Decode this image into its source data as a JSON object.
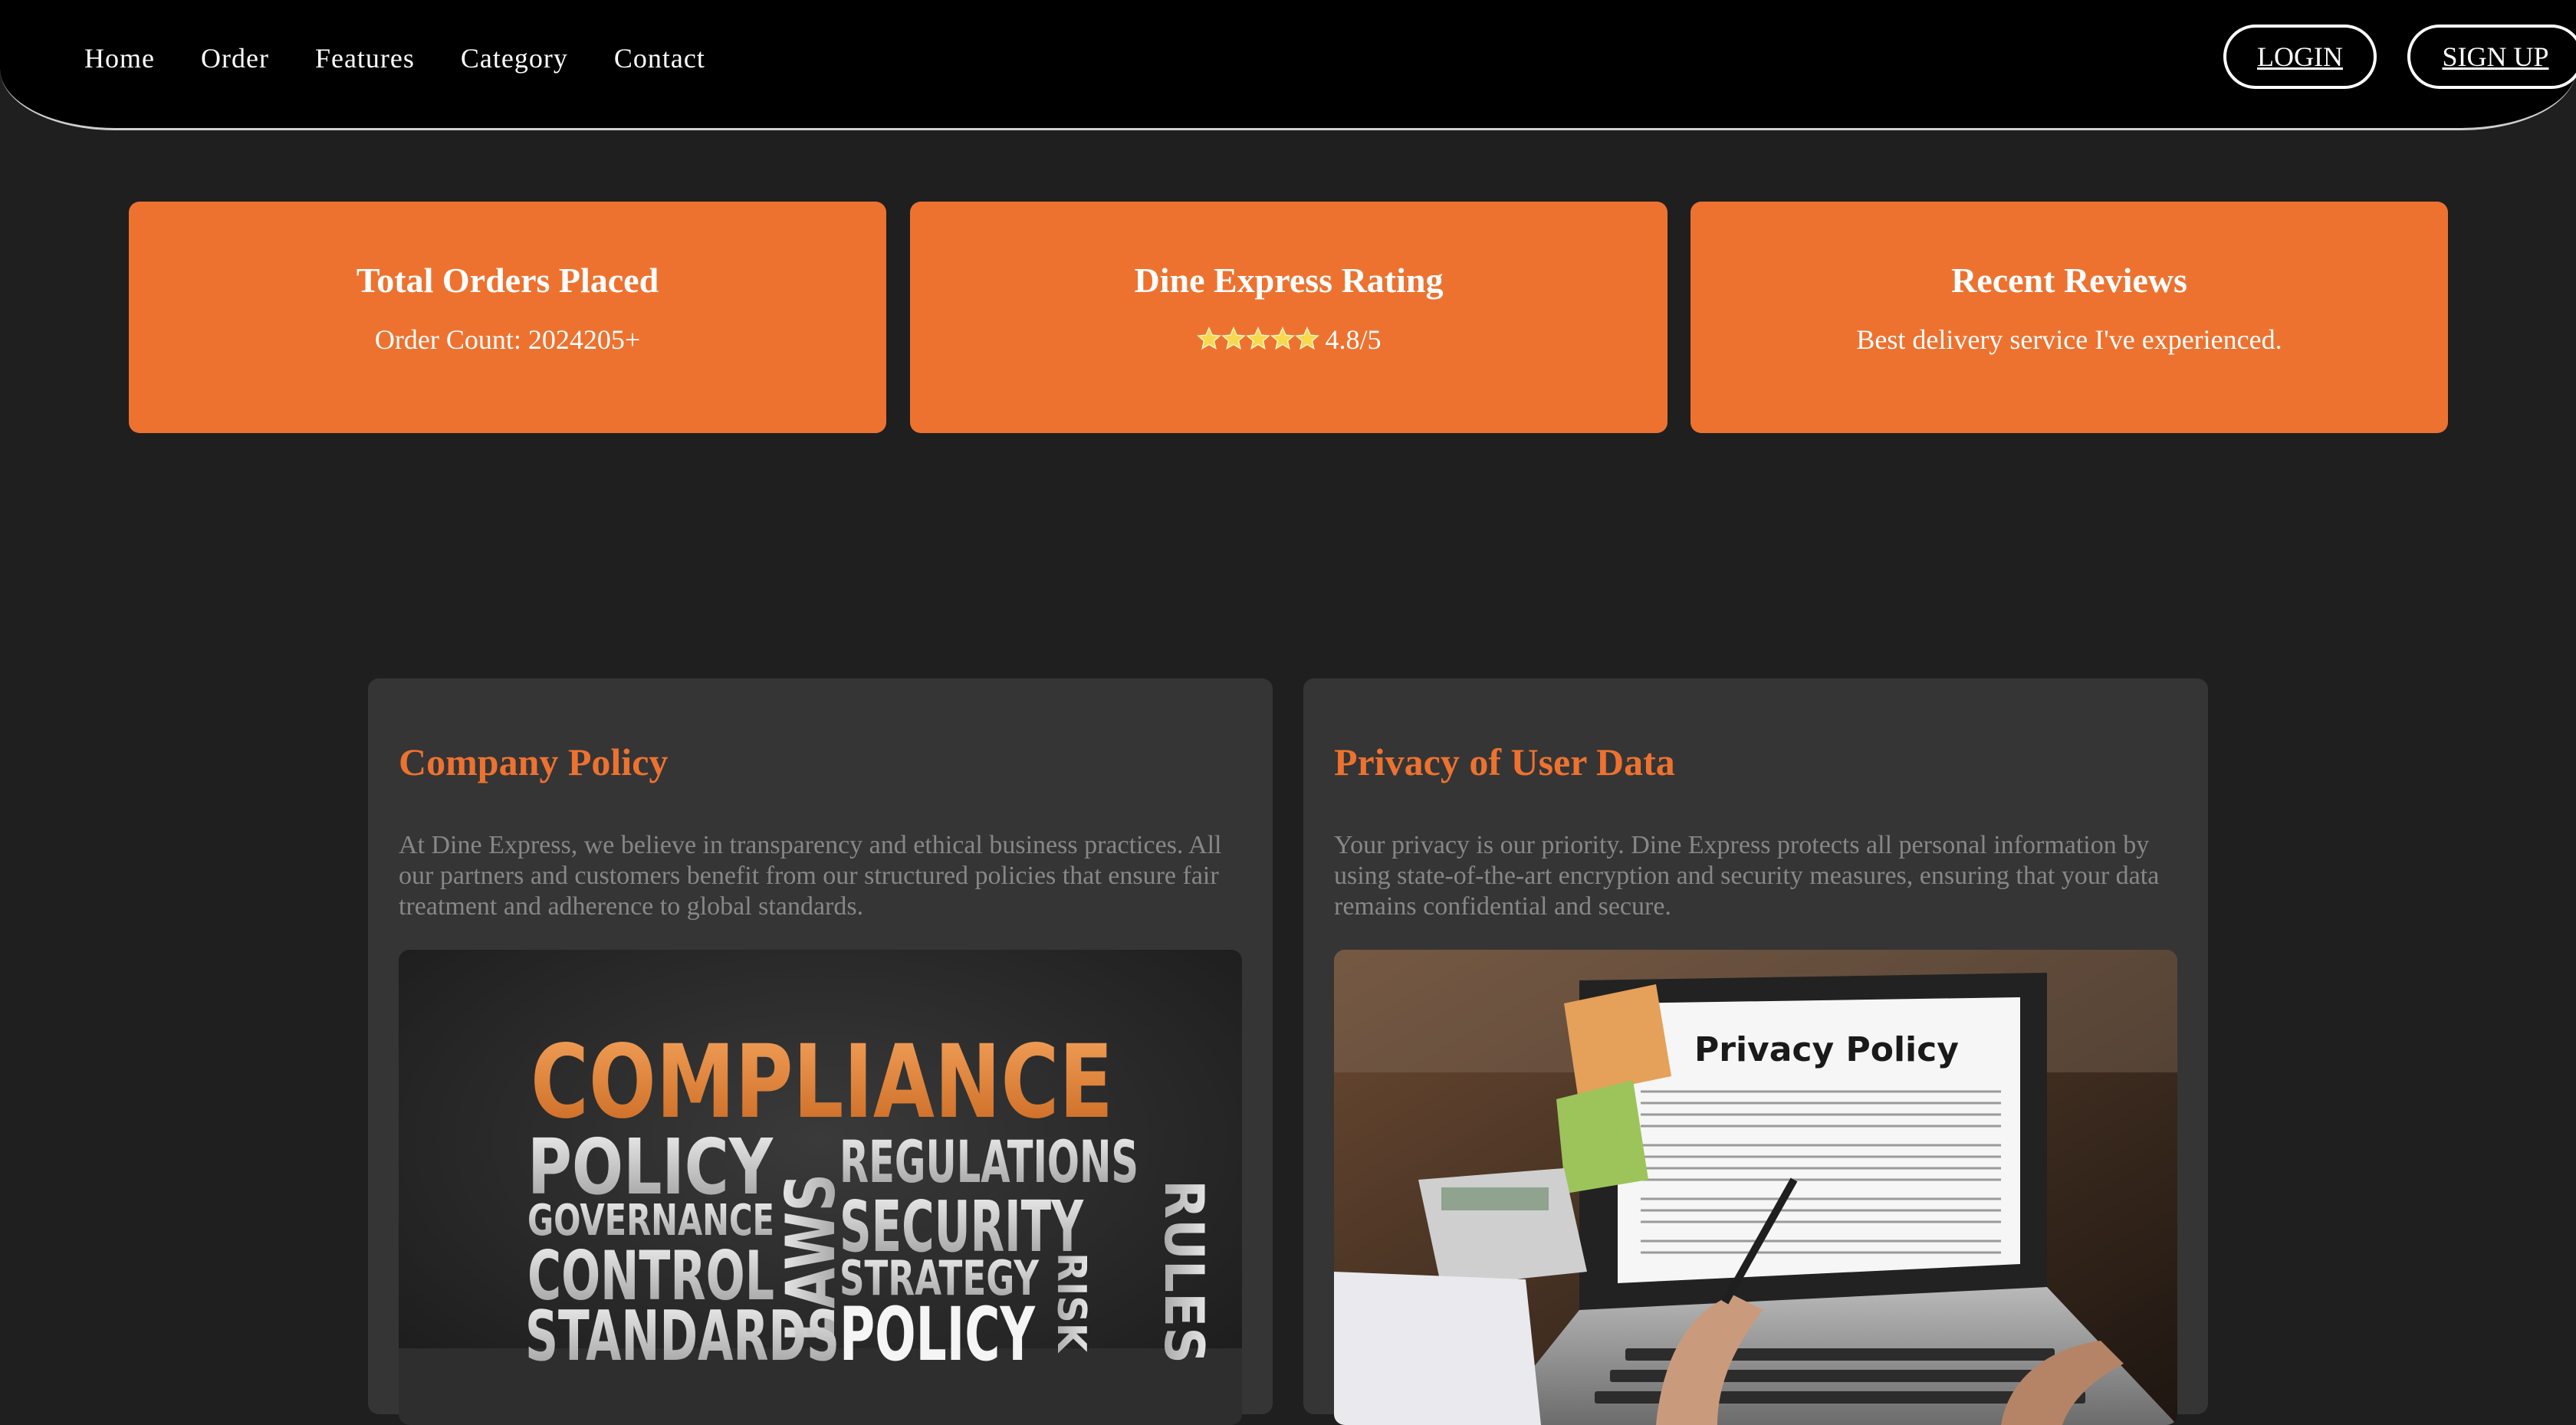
{
  "nav": {
    "items": [
      "Home",
      "Order",
      "Features",
      "Category",
      "Contact"
    ],
    "login_label": "LOGIN",
    "signup_label": "SIGN UP"
  },
  "stats": [
    {
      "title": "Total Orders Placed",
      "text": "Order Count: 2024205+"
    },
    {
      "title": "Dine Express Rating",
      "text": "4.8/5",
      "stars": 5
    },
    {
      "title": "Recent Reviews",
      "text": "Best delivery service I've experienced."
    }
  ],
  "policy": {
    "title": "Company Policy",
    "text": "At Dine Express, we believe in transparency and ethical business practices. All our partners and customers benefit from our structured policies that ensure fair treatment and adherence to global standards.",
    "image_words": [
      "COMPLIANCE",
      "POLICY",
      "REGULATIONS",
      "GOVERNANCE",
      "LAWS",
      "SECURITY",
      "RULES",
      "CONTROL",
      "STRATEGY",
      "RISK",
      "STANDARDS",
      "POLICY"
    ]
  },
  "privacy": {
    "title": "Privacy of User Data",
    "text": "Your privacy is our priority. Dine Express protects all personal information by using state-of-the-art encryption and security measures, ensuring that your data remains confidential and secure.",
    "image_heading": "Privacy Policy"
  },
  "colors": {
    "accent": "#ed7230",
    "background": "#1f1f1f",
    "card": "#353535",
    "nav": "#000000"
  }
}
